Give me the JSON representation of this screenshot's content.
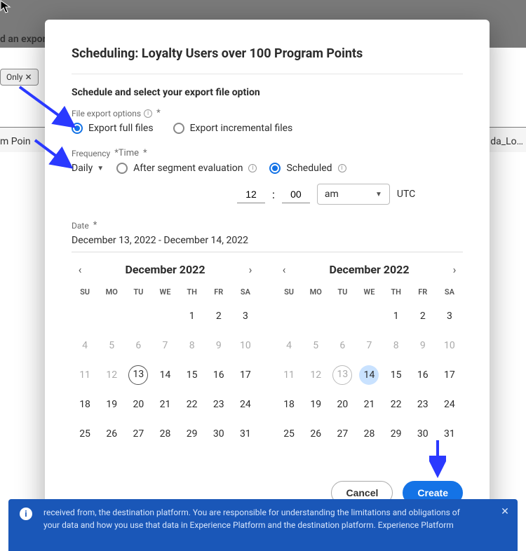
{
  "background": {
    "header_text": "d an export schedule for each segment.",
    "pill_left": "Only  ✕",
    "mid_left": "m Poin",
    "mid_right": "da_Lo…"
  },
  "modal": {
    "title": "Scheduling: Loyalty Users over 100 Program Points",
    "section_title": "Schedule and select your export file option",
    "file_export_label": "File export options",
    "radio_full": "Export full files",
    "radio_incremental": "Export incremental files",
    "frequency_label": "Frequency",
    "time_label_suffix": "*Time",
    "freq_daily": "Daily",
    "opt_after_eval": "After segment evaluation",
    "opt_scheduled": "Scheduled",
    "time_hour": "12",
    "time_min": "00",
    "ampm": "am",
    "utc": "UTC",
    "date_label": "Date",
    "date_range": "December 13, 2022 - December 14, 2022"
  },
  "calendar": {
    "month_title": "December 2022",
    "dow": [
      "SU",
      "MO",
      "TU",
      "WE",
      "TH",
      "FR",
      "SA"
    ],
    "left": {
      "today": 13,
      "selected": null,
      "days": [
        [
          "",
          "",
          "",
          "",
          "1",
          "2",
          "3"
        ],
        [
          "4",
          "5",
          "6",
          "7",
          "8",
          "9",
          "10"
        ],
        [
          "11",
          "12",
          "13",
          "14",
          "15",
          "16",
          "17"
        ],
        [
          "18",
          "19",
          "20",
          "21",
          "22",
          "23",
          "24"
        ],
        [
          "25",
          "26",
          "27",
          "28",
          "29",
          "30",
          "31"
        ]
      ],
      "muted": [
        "4",
        "5",
        "6",
        "7",
        "8",
        "9",
        "10",
        "11",
        "12"
      ]
    },
    "right": {
      "today": 13,
      "selected": 14,
      "days": [
        [
          "",
          "",
          "",
          "",
          "1",
          "2",
          "3"
        ],
        [
          "4",
          "5",
          "6",
          "7",
          "8",
          "9",
          "10"
        ],
        [
          "11",
          "12",
          "13",
          "14",
          "15",
          "16",
          "17"
        ],
        [
          "18",
          "19",
          "20",
          "21",
          "22",
          "23",
          "24"
        ],
        [
          "25",
          "26",
          "27",
          "28",
          "29",
          "30",
          "31"
        ]
      ],
      "muted": [
        "4",
        "5",
        "6",
        "7",
        "8",
        "9",
        "10",
        "11",
        "12",
        "13"
      ]
    }
  },
  "footer": {
    "cancel": "Cancel",
    "create": "Create"
  },
  "banner": {
    "line1": "received from, the destination platform. You are responsible for understanding the limitations and obligations of",
    "line2": "your data and how you use that data in Experience Platform and the destination platform. Experience Platform"
  }
}
